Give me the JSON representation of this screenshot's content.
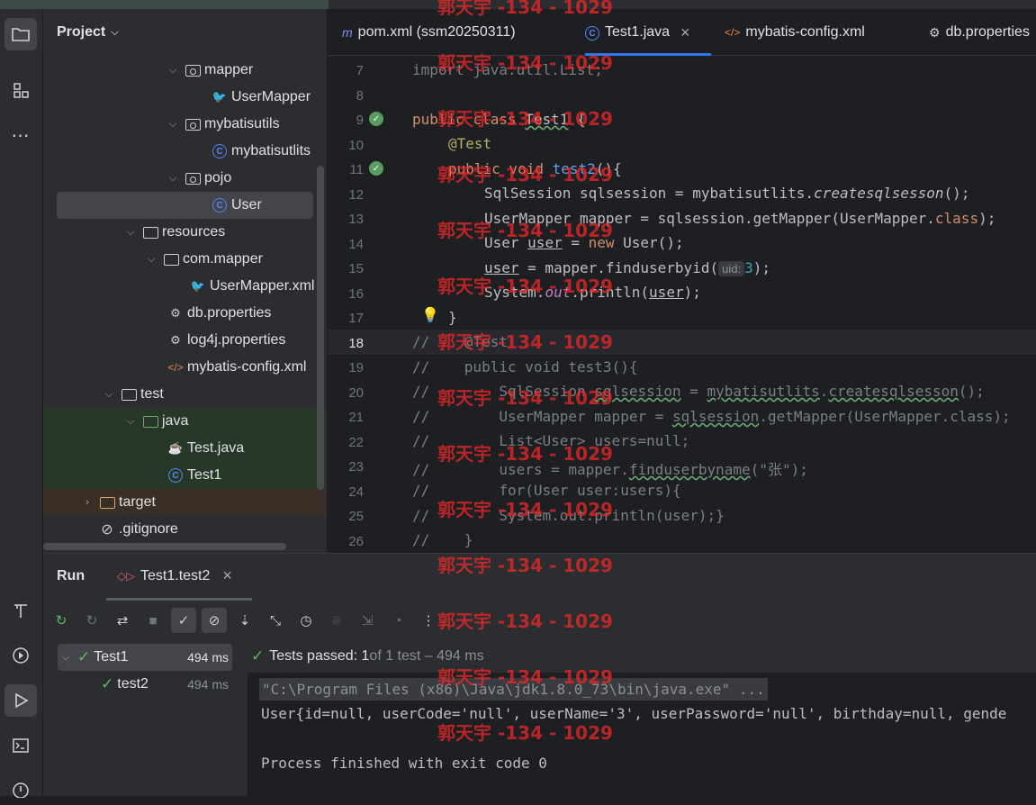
{
  "project_panel": {
    "title": "Project",
    "tree": [
      {
        "label": "mapper",
        "icon": "package-folder-icon"
      },
      {
        "label": "UserMapper",
        "icon": "mybatis-mapper-icon"
      },
      {
        "label": "mybatisutils",
        "icon": "package-folder-icon"
      },
      {
        "label": "mybatisutlits",
        "icon": "java-class-icon"
      },
      {
        "label": "pojo",
        "icon": "package-folder-icon"
      },
      {
        "label": "User",
        "icon": "java-class-icon"
      },
      {
        "label": "resources",
        "icon": "resources-folder-icon"
      },
      {
        "label": "com.mapper",
        "icon": "folder-icon"
      },
      {
        "label": "UserMapper.xml",
        "icon": "mybatis-xml-icon"
      },
      {
        "label": "db.properties",
        "icon": "properties-icon"
      },
      {
        "label": "log4j.properties",
        "icon": "properties-icon"
      },
      {
        "label": "mybatis-config.xml",
        "icon": "xml-icon"
      },
      {
        "label": "test",
        "icon": "folder-icon"
      },
      {
        "label": "java",
        "icon": "test-folder-icon"
      },
      {
        "label": "Test.java",
        "icon": "java-file-icon"
      },
      {
        "label": "Test1",
        "icon": "java-class-icon"
      },
      {
        "label": "target",
        "icon": "excluded-folder-icon"
      },
      {
        "label": ".gitignore",
        "icon": "ignored-file-icon"
      }
    ]
  },
  "editor": {
    "tabs": [
      {
        "label": "pom.xml (ssm20250311)",
        "icon": "maven-icon"
      },
      {
        "label": "Test1.java",
        "icon": "java-class-icon"
      },
      {
        "label": "mybatis-config.xml",
        "icon": "xml-icon"
      },
      {
        "label": "db.properties",
        "icon": "gear-icon"
      }
    ],
    "close_glyph": "×",
    "line_numbers": [
      "7",
      "8",
      "9",
      "10",
      "11",
      "12",
      "13",
      "14",
      "15",
      "16",
      "17",
      "18",
      "19",
      "20",
      "21",
      "22",
      "23",
      "24",
      "25",
      "26"
    ],
    "lines": {
      "l7": "import java.util.List;",
      "l9a": "public class ",
      "l9b": "Test1",
      "l9c": " {",
      "l10": "@Test",
      "l11a": "public void ",
      "l11b": "test2",
      "l11c": "(){",
      "l12a": "SqlSession sqlsession = mybatisutlits.",
      "l12b": "createsqlsesson",
      "l12c": "();",
      "l13a": "UserMapper mapper = sqlsession.getMapper(UserMapper.",
      "l13b": "class",
      "l13c": ");",
      "l14a": "User ",
      "l14b": "user",
      "l14c": " = ",
      "l14d": "new",
      "l14e": " User();",
      "l15a": "user",
      "l15b": " = mapper.finduserbyid(",
      "l15hint": "uid:",
      "l15c": "3",
      "l15d": ");",
      "l16a": "System.",
      "l16b": "out",
      "l16c": ".println(",
      "l16d": "user",
      "l16e": ");",
      "l17": "}",
      "l18": "//    @Test",
      "l19": "//    public void test3(){",
      "l20a": "//        SqlSession ",
      "l20b": "sqlsession",
      "l20c": " = ",
      "l20d": "mybatisutlits",
      "l20e": ".",
      "l20f": "createsqlsesson",
      "l20g": "();",
      "l21a": "//        UserMapper mapper = ",
      "l21b": "sqlsession",
      "l21c": ".getMapper(UserMapper.class);",
      "l22": "//        List<User> users=null;",
      "l23a": "//        users = mapper.",
      "l23b": "finduserbyname",
      "l23c": "(\"张\");",
      "l24": "//        for(User user:users){",
      "l25": "//        System.out.println(user);}",
      "l26": "//    }"
    }
  },
  "run_panel": {
    "title": "Run",
    "tab_label": "Test1.test2",
    "close_glyph": "×",
    "tree": [
      {
        "label": "Test1",
        "time": "494 ms"
      },
      {
        "label": "test2",
        "time": "494 ms"
      }
    ],
    "status_bold": "Tests passed: 1",
    "status_rest": " of 1 test – 494 ms",
    "console": {
      "cmd": "\"C:\\Program Files (x86)\\Java\\jdk1.8.0_73\\bin\\java.exe\" ...",
      "output": "User{id=null, userCode='null', userName='3', userPassword='null', birthday=null, gende",
      "exit": "Process finished with exit code 0"
    }
  },
  "watermark": "郭天宇 -134 - 1029",
  "colors": {
    "accent": "#3574f0",
    "success": "#5fb865",
    "keyword": "#cf8e6d",
    "annotation": "#b3ae60",
    "watermark": "#e62828"
  }
}
